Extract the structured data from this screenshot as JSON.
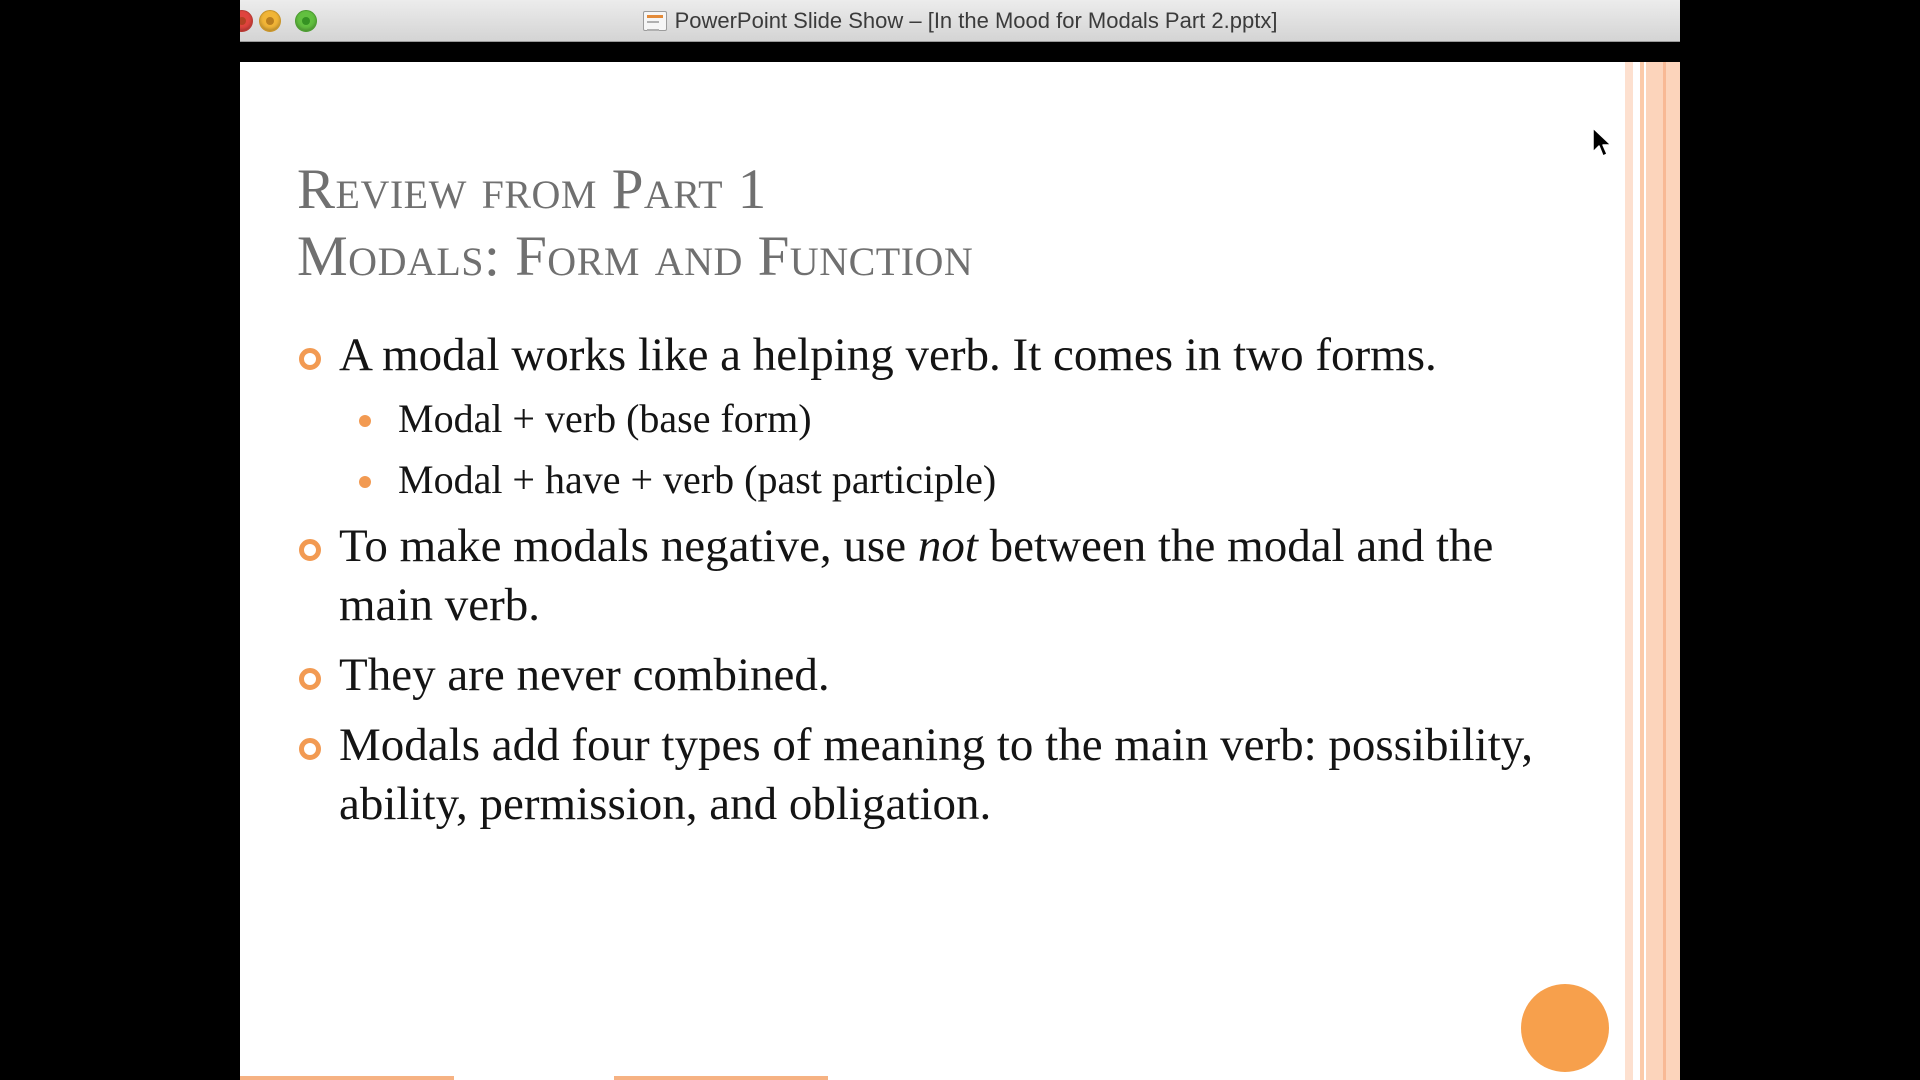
{
  "window": {
    "title": "PowerPoint Slide Show – [In the Mood for Modals Part 2.pptx]",
    "icon": "pptx-document-icon"
  },
  "slide": {
    "title_line1": "Review from Part 1",
    "title_line2": "Modals: Form and Function",
    "bullet1": "A modal works like a helping verb. It comes in two forms.",
    "bullet1_sub1": "Modal + verb (base form)",
    "bullet1_sub2": "Modal + have + verb (past participle)",
    "bullet2_before": "To make modals negative, use ",
    "bullet2_emph": "not",
    "bullet2_after": " between the modal and the main verb.",
    "bullet3": "They are never combined.",
    "bullet4": "Modals add four types of meaning to the main verb: possibility, ability, permission, and obligation."
  },
  "colors": {
    "accent": "#f29a52",
    "title_text": "#707070",
    "body_text": "#141414",
    "stripe": "#fcd4bb"
  }
}
